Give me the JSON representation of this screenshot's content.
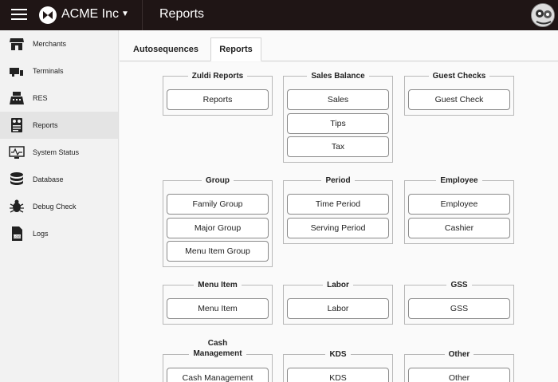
{
  "header": {
    "company": "ACME Inc",
    "page_title": "Reports"
  },
  "sidebar": {
    "items": [
      {
        "label": "Merchants",
        "icon": "storefront-icon"
      },
      {
        "label": "Terminals",
        "icon": "terminal-icon"
      },
      {
        "label": "RES",
        "icon": "register-icon"
      },
      {
        "label": "Reports",
        "icon": "reports-icon",
        "active": true
      },
      {
        "label": "System Status",
        "icon": "monitor-icon"
      },
      {
        "label": "Database",
        "icon": "database-icon"
      },
      {
        "label": "Debug Check",
        "icon": "bug-icon"
      },
      {
        "label": "Logs",
        "icon": "log-icon"
      }
    ]
  },
  "tabs": [
    {
      "label": "Autosequences"
    },
    {
      "label": "Reports",
      "active": true
    }
  ],
  "groups": {
    "zuldi": {
      "title": "Zuldi Reports",
      "buttons": [
        "Reports"
      ]
    },
    "sales_balance": {
      "title": "Sales Balance",
      "buttons": [
        "Sales",
        "Tips",
        "Tax"
      ]
    },
    "guest_checks": {
      "title": "Guest Checks",
      "buttons": [
        "Guest Check"
      ]
    },
    "group": {
      "title": "Group",
      "buttons": [
        "Family Group",
        "Major Group",
        "Menu Item Group"
      ]
    },
    "period": {
      "title": "Period",
      "buttons": [
        "Time Period",
        "Serving Period"
      ]
    },
    "employee": {
      "title": "Employee",
      "buttons": [
        "Employee",
        "Cashier"
      ]
    },
    "menu_item": {
      "title": "Menu Item",
      "buttons": [
        "Menu Item"
      ]
    },
    "labor": {
      "title": "Labor",
      "buttons": [
        "Labor"
      ]
    },
    "gss": {
      "title": "GSS",
      "buttons": [
        "GSS"
      ]
    },
    "cash_management": {
      "title_line1": "Cash",
      "title_line2": "Management",
      "buttons": [
        "Cash Management"
      ]
    },
    "kds": {
      "title": "KDS",
      "buttons": [
        "KDS"
      ]
    },
    "other": {
      "title": "Other",
      "buttons": [
        "Other"
      ]
    }
  }
}
